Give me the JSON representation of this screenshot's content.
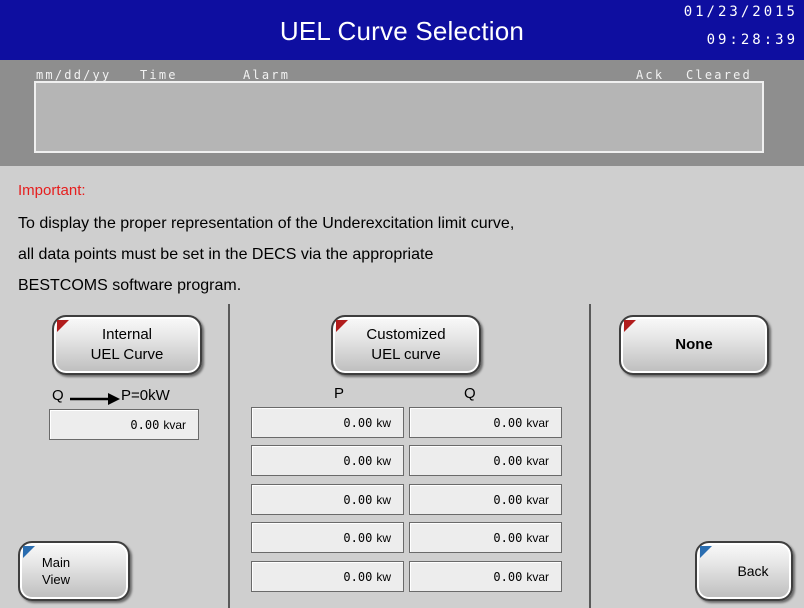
{
  "header": {
    "title": "UEL Curve Selection",
    "date": "01/23/2015",
    "time": "09:28:39"
  },
  "alarm_table": {
    "columns": {
      "date": "mm/dd/yy",
      "time": "Time",
      "alarm": "Alarm",
      "ack": "Ack",
      "cleared": "Cleared"
    },
    "rows": []
  },
  "notice": {
    "heading": "Important:",
    "lines": [
      "To display the proper representation of the Underexcitation limit curve,",
      "all data points must be set in the DECS via the appropriate",
      "BESTCOMS software program."
    ]
  },
  "left_panel": {
    "button": {
      "line1": "Internal",
      "line2": "UEL Curve"
    },
    "q_label": "Q",
    "p_label": "P=0kW",
    "value": {
      "number": "0.00",
      "unit": "kvar"
    }
  },
  "middle_panel": {
    "button": {
      "line1": "Customized",
      "line2": "UEL curve"
    },
    "p_header": "P",
    "q_header": "Q",
    "rows": [
      {
        "p": "0.00",
        "p_unit": "kw",
        "q": "0.00",
        "q_unit": "kvar"
      },
      {
        "p": "0.00",
        "p_unit": "kw",
        "q": "0.00",
        "q_unit": "kvar"
      },
      {
        "p": "0.00",
        "p_unit": "kw",
        "q": "0.00",
        "q_unit": "kvar"
      },
      {
        "p": "0.00",
        "p_unit": "kw",
        "q": "0.00",
        "q_unit": "kvar"
      },
      {
        "p": "0.00",
        "p_unit": "kw",
        "q": "0.00",
        "q_unit": "kvar"
      }
    ]
  },
  "right_panel": {
    "button": "None"
  },
  "nav": {
    "main_view": {
      "line1": "Main",
      "line2": "View"
    },
    "back": "Back"
  },
  "colors": {
    "header_bg": "#0e0ea0",
    "important_text": "#e61e1e",
    "screen_bg": "#cfcfcf",
    "alarm_strip": "#8e8e8e"
  }
}
